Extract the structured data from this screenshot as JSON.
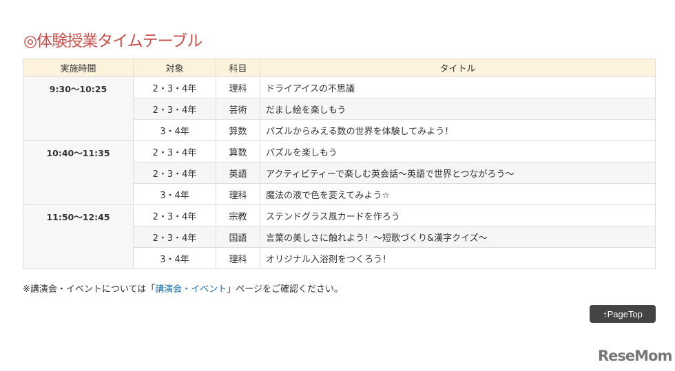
{
  "title": "◎体験授業タイムテーブル",
  "headers": [
    "実施時間",
    "対象",
    "科目",
    "タイトル"
  ],
  "groups": [
    {
      "time": "9:30～10:25",
      "rows": [
        {
          "target": "2・3・4年",
          "subject": "理科",
          "title": "ドライアイスの不思議"
        },
        {
          "target": "2・3・4年",
          "subject": "芸術",
          "title": "だまし絵を楽しもう"
        },
        {
          "target": "3・4年",
          "subject": "算数",
          "title": "パズルからみえる数の世界を体験してみよう！"
        }
      ]
    },
    {
      "time": "10:40～11:35",
      "rows": [
        {
          "target": "2・3・4年",
          "subject": "算数",
          "title": "パズルを楽しもう"
        },
        {
          "target": "2・3・4年",
          "subject": "英語",
          "title": "アクティビティーで楽しむ英会話～英語で世界とつながろう～"
        },
        {
          "target": "3・4年",
          "subject": "理科",
          "title": "魔法の液で色を変えてみよう☆"
        }
      ]
    },
    {
      "time": "11:50～12:45",
      "rows": [
        {
          "target": "2・3・4年",
          "subject": "宗教",
          "title": "ステンドグラス風カードを作ろう"
        },
        {
          "target": "2・3・4年",
          "subject": "国語",
          "title": "言葉の美しさに触れよう！～短歌づくり&漢字クイズ～"
        },
        {
          "target": "3・4年",
          "subject": "理科",
          "title": "オリジナル入浴剤をつくろう！"
        }
      ]
    }
  ],
  "note": {
    "before": "※講演会・イベントについては「",
    "link": "講演会・イベント",
    "after": "」ページをご確認ください。"
  },
  "pagetop": "↑PageTop",
  "logo": "ReseMom"
}
